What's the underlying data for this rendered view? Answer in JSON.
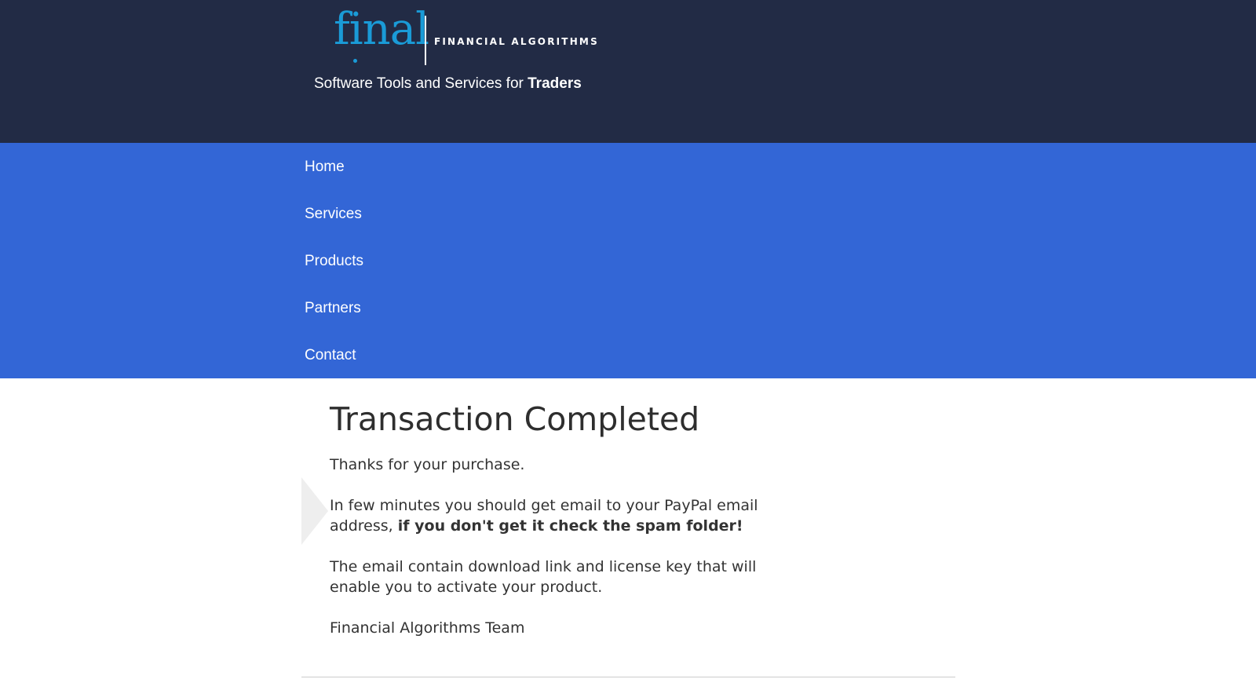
{
  "header": {
    "logo_word": "final",
    "logo_subtitle": "FINANCIAL ALGORITHMS",
    "tagline_prefix": "Software Tools and Services for ",
    "tagline_bold": "Traders"
  },
  "nav": {
    "items": [
      {
        "label": "Home"
      },
      {
        "label": "Services"
      },
      {
        "label": "Products"
      },
      {
        "label": "Partners"
      },
      {
        "label": "Contact"
      }
    ]
  },
  "main": {
    "title": "Transaction Completed",
    "p1": "Thanks for your purchase.",
    "p2_text": "In few minutes you should get email to your PayPal email address, ",
    "p2_bold": "if you don't get it check the spam folder!",
    "p3": "The email contain download link and license key that will enable you to activate your product.",
    "signature": "Financial Algorithms Team"
  },
  "colors": {
    "header_bg": "#222b45",
    "nav_bg": "#3366d6",
    "logo_accent": "#1a9bd7"
  }
}
